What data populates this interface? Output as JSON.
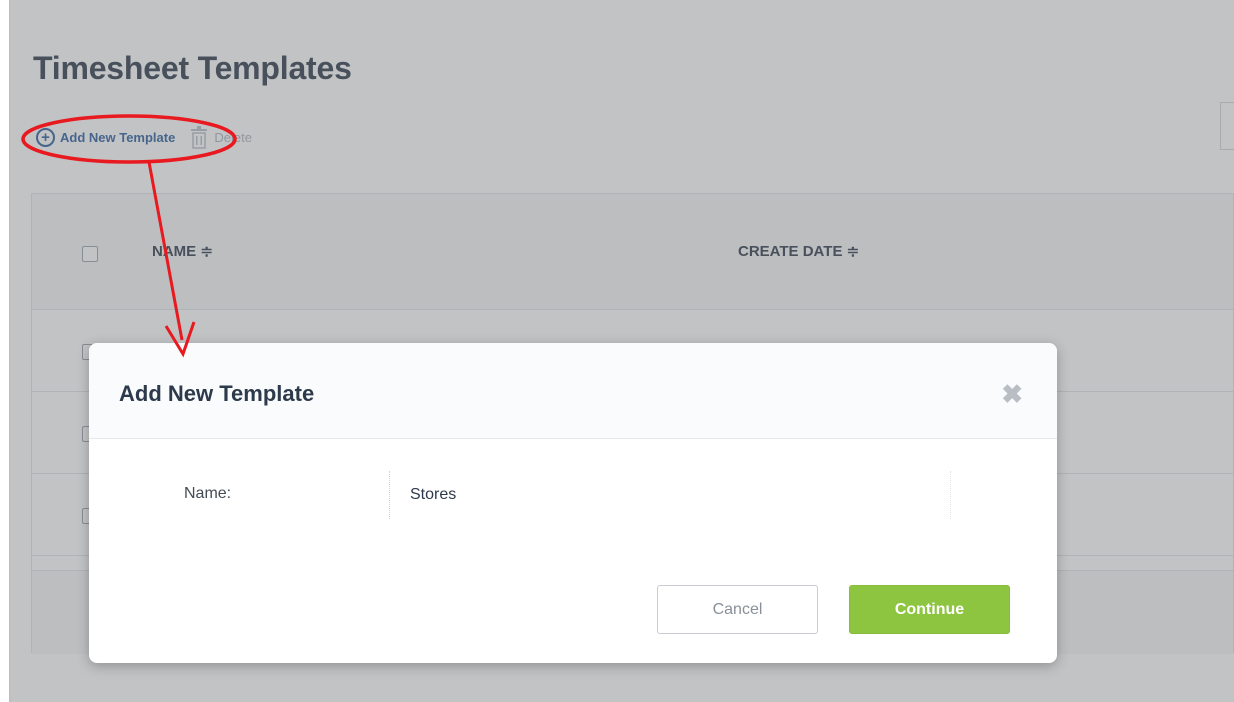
{
  "page": {
    "title": "Timesheet Templates"
  },
  "toolbar": {
    "add_label": "Add New Template",
    "delete_label": "Delete"
  },
  "table": {
    "columns": [
      {
        "label": "NAME",
        "sort_icon": "sort-icon"
      },
      {
        "label": "CREATE DATE",
        "sort_icon": "sort-icon"
      }
    ],
    "sort_glyph": "≑"
  },
  "modal": {
    "title": "Add New Template",
    "close_glyph": "✖",
    "name_label": "Name:",
    "name_value": "Stores",
    "cancel_label": "Cancel",
    "continue_label": "Continue"
  },
  "colors": {
    "accent_blue": "#2a5d9f",
    "continue_green": "#8ec540",
    "annotation_red": "#e8191f"
  }
}
